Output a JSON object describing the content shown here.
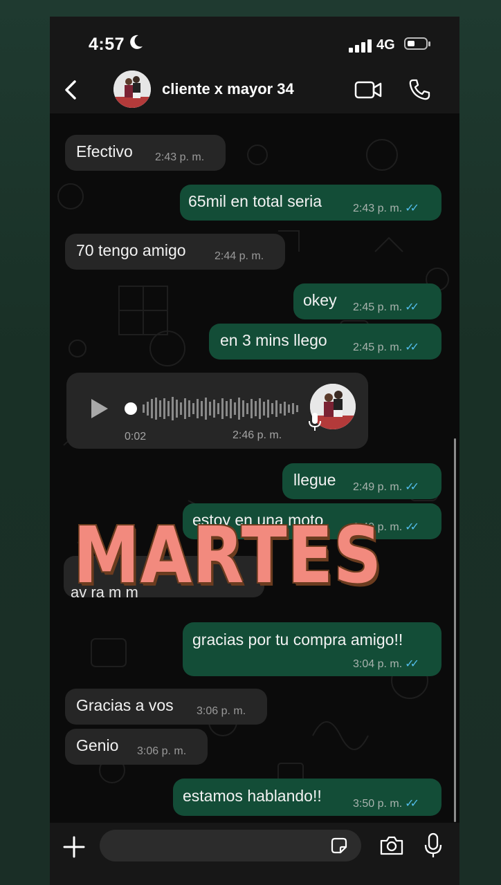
{
  "status_bar": {
    "time": "4:57",
    "network": "4G",
    "moon_icon": "moon-icon",
    "signal_icon": "signal-bars-icon",
    "battery_icon": "battery-icon"
  },
  "header": {
    "contact_name": "cliente x mayor 34",
    "back_icon": "chevron-left-icon",
    "video_icon": "video-call-icon",
    "call_icon": "phone-call-icon"
  },
  "colors": {
    "incoming_bubble": "#262626",
    "outgoing_bubble": "#134d37",
    "read_ticks": "#53bdeb",
    "sticker_fill": "#f28a7e",
    "sticker_outline": "#6b3c1f"
  },
  "messages": [
    {
      "dir": "in",
      "text": "Efectivo",
      "time": "2:43 p. m."
    },
    {
      "dir": "out",
      "text": "65mil en total seria",
      "time": "2:43 p. m.",
      "read": true
    },
    {
      "dir": "in",
      "text": "70 tengo amigo",
      "time": "2:44 p. m."
    },
    {
      "dir": "out",
      "text": "okey",
      "time": "2:45 p. m.",
      "read": true
    },
    {
      "dir": "out",
      "text": "en 3 mins llego",
      "time": "2:45 p. m.",
      "read": true
    },
    {
      "dir": "in",
      "type": "voice",
      "duration": "0:02",
      "time": "2:46 p. m."
    },
    {
      "dir": "out",
      "text": "llegue",
      "time": "2:49 p. m.",
      "read": true
    },
    {
      "dir": "out",
      "text": "estoy en una moto",
      "time": "2:49 p. m.",
      "read": true
    },
    {
      "dir": "out",
      "text": "gracias por tu compra amigo!!",
      "time": "3:04 p. m.",
      "read": true
    },
    {
      "dir": "in",
      "text": "Gracias a vos",
      "time": "3:06 p. m."
    },
    {
      "dir": "in",
      "text": "Genio",
      "time": "3:06 p. m."
    },
    {
      "dir": "out",
      "text": "estamos hablando!!",
      "time": "3:50 p. m.",
      "read": true
    }
  ],
  "obscured_message_fragment": "av  ra   m   m",
  "sticker_text": "MARTES",
  "input_bar": {
    "plus_icon": "plus-icon",
    "sticker_icon": "sticker-icon",
    "camera_icon": "camera-icon",
    "mic_icon": "microphone-icon"
  }
}
